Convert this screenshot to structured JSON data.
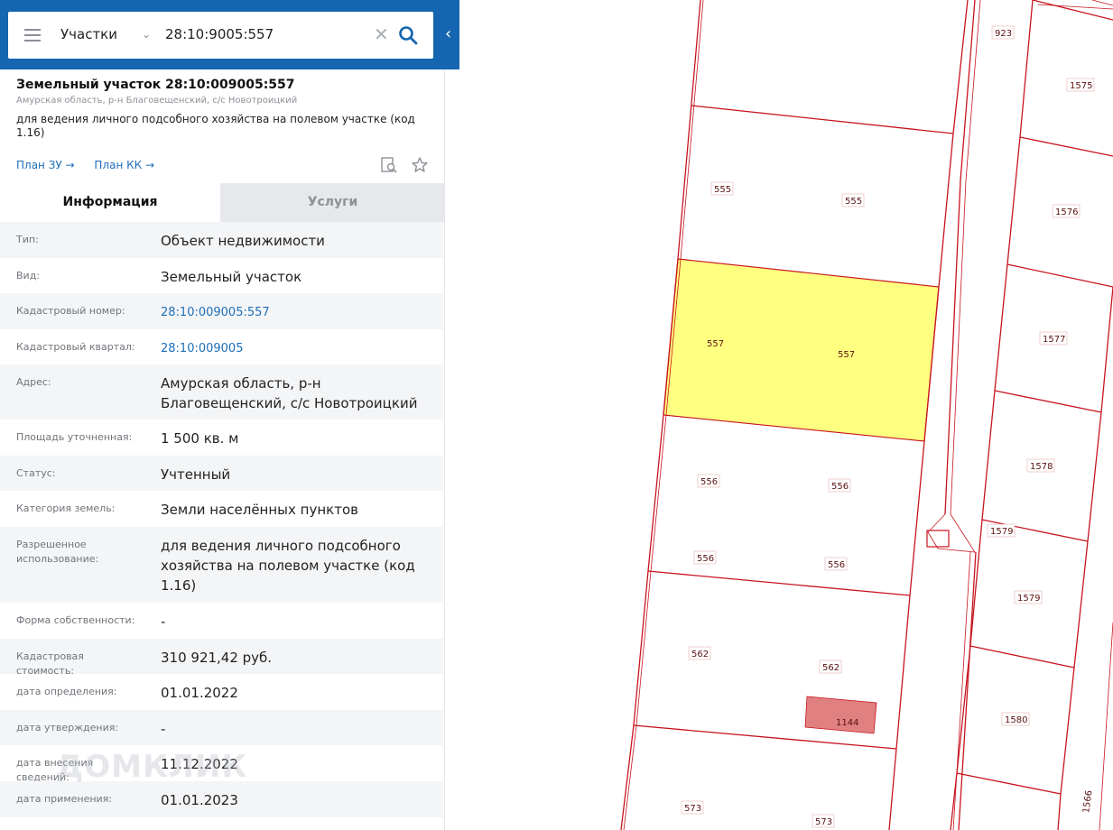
{
  "search": {
    "layer": "Участки",
    "query": "28:10:9005:557"
  },
  "header": {
    "title": "Земельный участок 28:10:009005:557",
    "subtitle": "Амурская область, р-н Благовещенский, с/с Новотроицкий",
    "purpose": "для ведения личного подсобного хозяйства на полевом участке (код 1.16)",
    "link_plan_zu": "План ЗУ →",
    "link_plan_kk": "План КК →"
  },
  "tabs": {
    "info": "Информация",
    "services": "Услуги"
  },
  "rows": [
    {
      "label": "Тип:",
      "value": "Объект недвижимости"
    },
    {
      "label": "Вид:",
      "value": "Земельный участок"
    },
    {
      "label": "Кадастровый номер:",
      "value": "28:10:009005:557"
    },
    {
      "label": "Кадастровый квартал:",
      "value": "28:10:009005"
    },
    {
      "label": "Адрес:",
      "value": "Амурская область, р-н Благовещенский, с/с Новотроицкий"
    },
    {
      "label": "Площадь уточненная:",
      "value": "1 500 кв. м"
    },
    {
      "label": "Статус:",
      "value": "Учтенный"
    },
    {
      "label": "Категория земель:",
      "value": "Земли населённых пунктов"
    },
    {
      "label": "Разрешенное использование:",
      "value": "для ведения личного подсобного хозяйства на полевом участке (код 1.16)"
    },
    {
      "label": "Форма собственности:",
      "value": "-"
    },
    {
      "label": "Кадастровая стоимость:",
      "value": "310 921,42 руб."
    },
    {
      "label": "дата определения:",
      "value": "01.01.2022"
    },
    {
      "label": "дата утверждения:",
      "value": "-"
    },
    {
      "label": "дата внесения сведений:",
      "value": "11.12.2022"
    },
    {
      "label": "дата применения:",
      "value": "01.01.2023"
    }
  ],
  "watermark": "ДОМКЛИК",
  "map": {
    "parcels": [
      "923",
      "1575",
      "555",
      "555",
      "1576",
      "557",
      "557",
      "1577",
      "556",
      "556",
      "1578",
      "1579",
      "556",
      "556",
      "1579",
      "562",
      "562",
      "1144",
      "1580",
      "573",
      "573",
      "1566"
    ]
  },
  "colors": {
    "brand": "#1565b0",
    "link": "#1d6fb8",
    "parcel_line": "#c8141e",
    "selected_fill": "#ffff80",
    "building_fill": "#e08080"
  },
  "icons": {
    "menu": "menu-icon",
    "chevron": "chevron-down-icon",
    "clear": "close-icon",
    "search": "search-icon",
    "collapse": "chevron-left-icon",
    "plan_view": "document-search-icon",
    "favorite": "star-icon"
  }
}
